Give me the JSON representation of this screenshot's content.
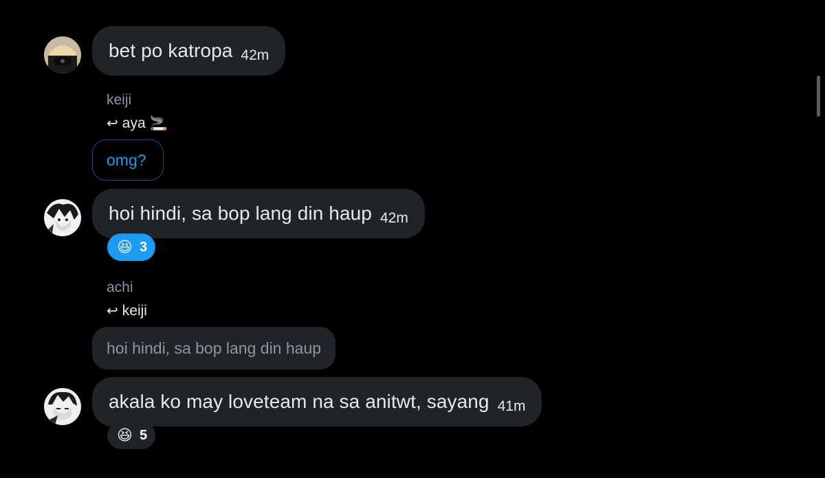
{
  "theme": {
    "background": "#000000",
    "bubble": "#202327",
    "accent": "#1d9bf0",
    "muted_text": "#8b98a5",
    "text": "#e7e9ea"
  },
  "messages": [
    {
      "avatar": "avatar-masked-user",
      "text": "bet po katropa",
      "time": "42m"
    },
    {
      "reply_name": "keiji",
      "reply_to": "aya 🚬",
      "quote": "omg?",
      "avatar": "avatar-manga-user",
      "text": "hoi hindi, sa bop lang din haup",
      "time": "42m",
      "reaction": {
        "emoji": "😆",
        "count": "3",
        "selected": true
      }
    },
    {
      "reply_name": "achi",
      "reply_to": "keiji",
      "quote": "hoi hindi, sa bop lang din haup",
      "avatar": "avatar-manga-user-2",
      "text": "akala ko may loveteam na sa anitwt, sayang",
      "time": "41m",
      "reaction": {
        "emoji": "😆",
        "count": "5",
        "selected": false
      }
    }
  ],
  "icons": {
    "reply": "reply-arrow-icon",
    "reaction": "laughing-face-icon"
  }
}
